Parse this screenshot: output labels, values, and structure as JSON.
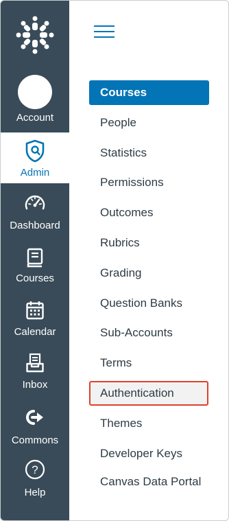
{
  "global_nav": {
    "account_label": "Account",
    "admin_label": "Admin",
    "dashboard_label": "Dashboard",
    "courses_label": "Courses",
    "calendar_label": "Calendar",
    "inbox_label": "Inbox",
    "commons_label": "Commons",
    "help_label": "Help"
  },
  "sub_nav": {
    "items": [
      {
        "label": "Courses"
      },
      {
        "label": "People"
      },
      {
        "label": "Statistics"
      },
      {
        "label": "Permissions"
      },
      {
        "label": "Outcomes"
      },
      {
        "label": "Rubrics"
      },
      {
        "label": "Grading"
      },
      {
        "label": "Question Banks"
      },
      {
        "label": "Sub-Accounts"
      },
      {
        "label": "Terms"
      },
      {
        "label": "Authentication"
      },
      {
        "label": "Themes"
      },
      {
        "label": "Developer Keys"
      },
      {
        "label": "Canvas Data Portal"
      }
    ],
    "active_item": "Courses",
    "highlighted_item": "Authentication"
  },
  "colors": {
    "nav_bg": "#394b58",
    "brand_blue": "#0374b5",
    "highlight_border": "#e0402a"
  }
}
